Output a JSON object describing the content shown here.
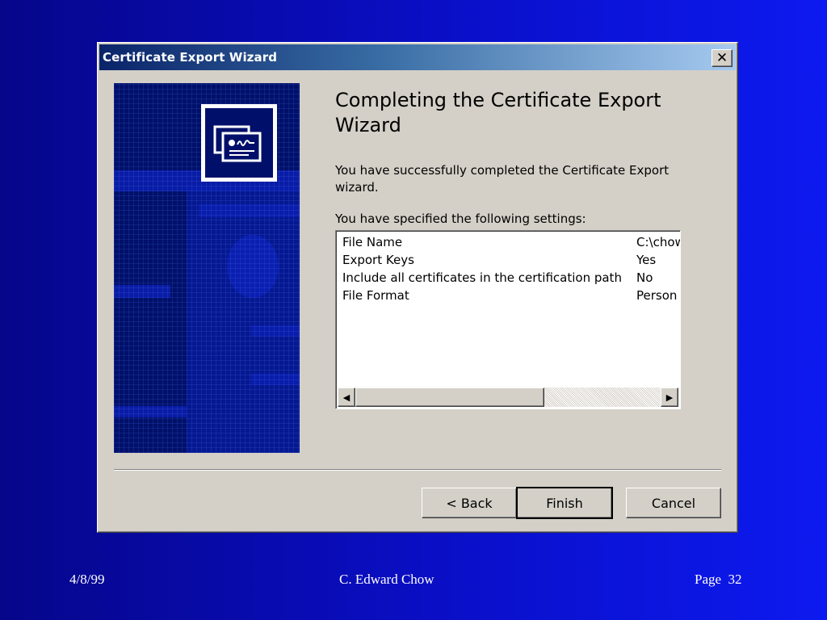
{
  "window": {
    "title": "Certificate Export Wizard",
    "close_glyph": "✕"
  },
  "banner": {
    "icon": "certificate-icon"
  },
  "content": {
    "heading_line1": "Completing the Certificate Export",
    "heading_line2": "Wizard",
    "intro_line1": "You have successfully completed the Certificate Export",
    "intro_line2": "wizard.",
    "settings_label": "You have specified the following settings:",
    "settings": [
      {
        "key": "File Name",
        "value": "C:\\chow"
      },
      {
        "key": "Export Keys",
        "value": "Yes"
      },
      {
        "key": "Include all certificates in the certification path",
        "value": "No"
      },
      {
        "key": "File Format",
        "value": "Person"
      }
    ],
    "scroll_left_glyph": "◀",
    "scroll_right_glyph": "▶"
  },
  "buttons": {
    "back": "< Back",
    "finish": "Finish",
    "cancel": "Cancel"
  },
  "footer": {
    "date": "4/8/99",
    "author": "C. Edward Chow",
    "page": "Page  32"
  }
}
